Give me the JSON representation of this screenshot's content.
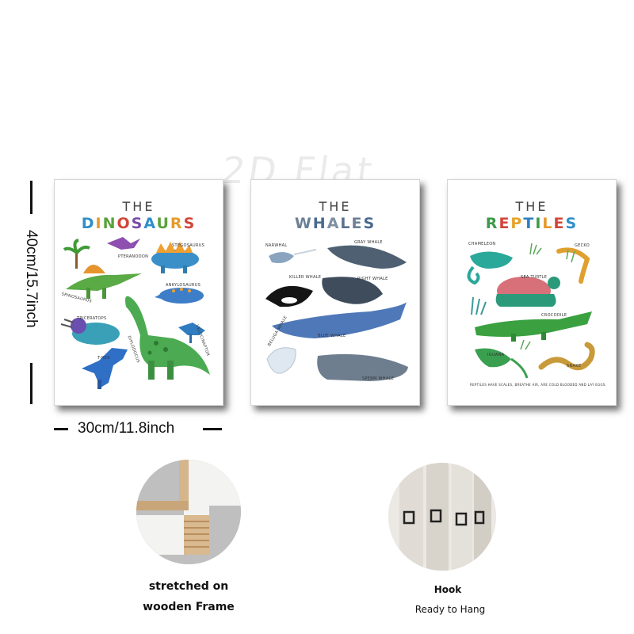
{
  "watermark": "2D Flat",
  "dimensions": {
    "height": "40cm/15.7inch",
    "width": "30cm/11.8inch"
  },
  "posters": [
    {
      "the": "THE",
      "title": "DINOSAURS",
      "labels": [
        "PTERANODON",
        "STEGOSAURUS",
        "SPINOSAURUS",
        "ANKYLOSAURUS",
        "TRICERATOPS",
        "DIPLODOCUS",
        "VELOCIRAPTOR",
        "T-REX"
      ]
    },
    {
      "the": "THE",
      "title": "WHALES",
      "labels": [
        "NARWHAL",
        "GRAY WHALE",
        "KILLER WHALE",
        "RIGHT WHALE",
        "BLUE WHALE",
        "BELUGA WHALE",
        "SPERM WHALE"
      ]
    },
    {
      "the": "THE",
      "title": "REPTILES",
      "labels": [
        "CHAMELEON",
        "GECKO",
        "SEA TURTLE",
        "CROCODILE",
        "IGUANA",
        "SNAKE"
      ],
      "footnote": "REPTILES HAVE SCALES, BREATHE AIR, ARE COLD BLOODED AND LAY EGGS."
    }
  ],
  "features": [
    {
      "line1": "stretched on",
      "line2": "wooden Frame"
    },
    {
      "line1": "Hook",
      "line2": "Ready to Hang"
    }
  ],
  "title_colors": {
    "dinosaurs": [
      "#2f8fc9",
      "#e59a2b",
      "#5aa33c",
      "#d2463a",
      "#7a4aa8",
      "#2f8fc9",
      "#5aa33c",
      "#e59a2b",
      "#d2463a"
    ],
    "whales": [
      "#6b7f95",
      "#4a6a8f",
      "#7d8fa3",
      "#5b7190",
      "#6b7f95",
      "#4a6a8f"
    ],
    "reptiles": [
      "#3c9a4a",
      "#d2463a",
      "#e5a22b",
      "#2f7fc0",
      "#3c9a4a",
      "#e59a2b",
      "#d2463a",
      "#2f8fc9"
    ]
  }
}
